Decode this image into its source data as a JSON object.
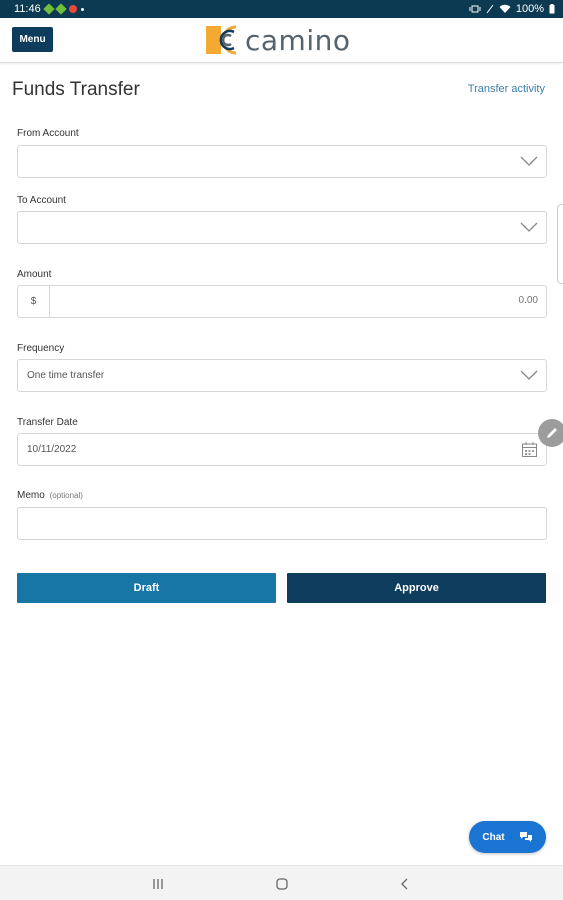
{
  "status_bar": {
    "time": "11:46",
    "battery": "100%"
  },
  "header": {
    "menu_label": "Menu",
    "brand_name": "camino",
    "colors": {
      "primary": "#0d3c5c",
      "accent": "#f0a830"
    }
  },
  "page": {
    "title": "Funds Transfer",
    "transfer_activity_link": "Transfer activity"
  },
  "form": {
    "from_account": {
      "label": "From Account",
      "value": ""
    },
    "to_account": {
      "label": "To Account",
      "value": ""
    },
    "amount": {
      "label": "Amount",
      "prefix": "$",
      "placeholder": "0.00"
    },
    "frequency": {
      "label": "Frequency",
      "value": "One time transfer"
    },
    "transfer_date": {
      "label": "Transfer Date",
      "value": "10/11/2022"
    },
    "memo": {
      "label": "Memo",
      "optional_label": "(optional)",
      "value": ""
    }
  },
  "actions": {
    "draft_label": "Draft",
    "approve_label": "Approve"
  },
  "chat": {
    "label": "Chat",
    "icon": "chat-bubbles-icon"
  },
  "nav": {
    "icons": [
      "recent-apps-icon",
      "home-icon",
      "back-icon"
    ]
  }
}
